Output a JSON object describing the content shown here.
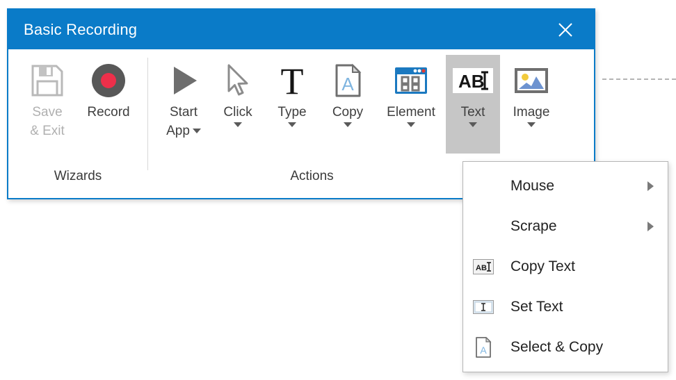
{
  "window": {
    "title": "Basic Recording",
    "close_icon": "close-icon",
    "accent_color": "#0a7bc8",
    "titlebar_text_color": "#ffffff"
  },
  "ribbon": {
    "groups": [
      {
        "label": "Wizards",
        "buttons": [
          {
            "label_line1": "Save",
            "label_line2": "& Exit",
            "icon": "save-floppy-icon",
            "disabled": true,
            "has_caret": false,
            "active": false
          },
          {
            "label_line1": "Record",
            "label_line2": "",
            "icon": "record-circle-icon",
            "disabled": false,
            "has_caret": false,
            "active": false
          }
        ]
      },
      {
        "label": "Actions",
        "buttons": [
          {
            "label_line1": "Start",
            "label_line2": "App",
            "icon": "play-triangle-icon",
            "disabled": false,
            "has_caret": true,
            "caret_inline": true,
            "active": false
          },
          {
            "label_line1": "Click",
            "label_line2": "",
            "icon": "mouse-pointer-icon",
            "disabled": false,
            "has_caret": true,
            "caret_inline": false,
            "active": false
          },
          {
            "label_line1": "Type",
            "label_line2": "",
            "icon": "letter-t-icon",
            "disabled": false,
            "has_caret": true,
            "caret_inline": false,
            "active": false
          },
          {
            "label_line1": "Copy",
            "label_line2": "",
            "icon": "document-a-icon",
            "disabled": false,
            "has_caret": true,
            "caret_inline": false,
            "active": false
          },
          {
            "label_line1": "Element",
            "label_line2": "",
            "icon": "window-elements-icon",
            "disabled": false,
            "has_caret": true,
            "caret_inline": false,
            "active": false
          },
          {
            "label_line1": "Text",
            "label_line2": "",
            "icon": "ab-cursor-icon",
            "disabled": false,
            "has_caret": true,
            "caret_inline": false,
            "active": true
          },
          {
            "label_line1": "Image",
            "label_line2": "",
            "icon": "picture-icon",
            "disabled": false,
            "has_caret": true,
            "caret_inline": false,
            "active": false
          }
        ]
      }
    ]
  },
  "text_menu": {
    "items": [
      {
        "label": "Mouse",
        "icon": "",
        "has_submenu": true
      },
      {
        "label": "Scrape",
        "icon": "",
        "has_submenu": true
      },
      {
        "label": "Copy Text",
        "icon": "ab-cursor-icon",
        "has_submenu": false
      },
      {
        "label": "Set Text",
        "icon": "text-field-icon",
        "has_submenu": false
      },
      {
        "label": "Select & Copy",
        "icon": "document-a-icon",
        "has_submenu": false
      }
    ]
  }
}
